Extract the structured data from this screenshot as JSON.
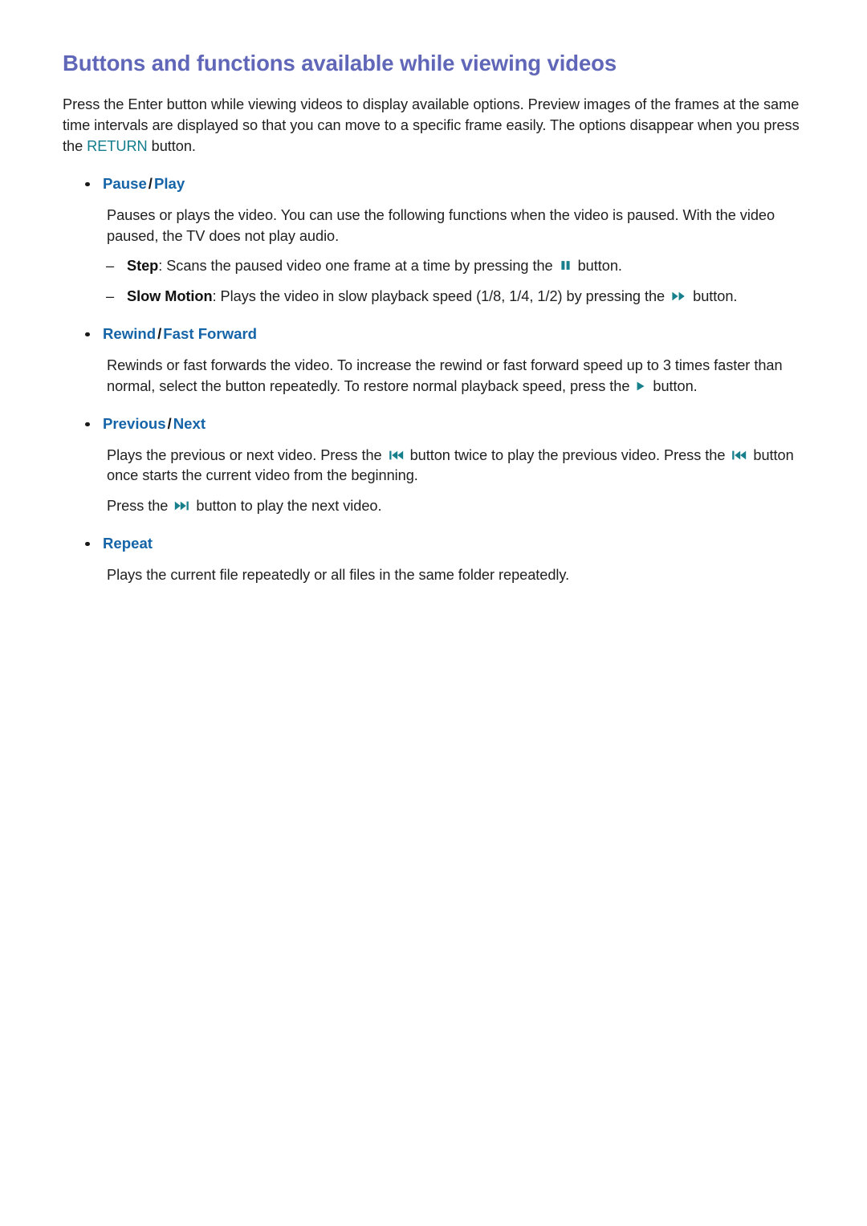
{
  "document": {
    "title": "Buttons and functions available while viewing videos",
    "intro_part1": "Press the Enter button while viewing videos to display available options. Preview images of the frames at the same time intervals are displayed so that you can move to a specific frame easily. The options disappear when you press the ",
    "intro_keyword": "RETURN",
    "intro_part2": " button."
  },
  "sections": [
    {
      "heading_first": "Pause",
      "heading_sep": "/",
      "heading_second": "Play",
      "paragraph": "Pauses or plays the video. You can use the following functions when the video is paused. With the video paused, the TV does not play audio.",
      "sub_items": [
        {
          "marker": "–",
          "label": "Step",
          "text_before": ": Scans the paused video one frame at a time by pressing the ",
          "icon": "pause-icon",
          "text_after": " button."
        },
        {
          "marker": "–",
          "label": "Slow Motion",
          "text_before": ": Plays the video in slow playback speed (1/8, 1/4, 1/2) by pressing the ",
          "icon": "fast-forward-icon",
          "text_after": " button."
        }
      ]
    },
    {
      "heading_first": "Rewind",
      "heading_sep": "/",
      "heading_second": "Fast Forward",
      "paragraph_before_icon": "Rewinds or fast forwards the video. To increase the rewind or fast forward speed up to 3 times faster than normal, select the button repeatedly. To restore normal playback speed, press the ",
      "icon": "play-icon",
      "paragraph_after_icon": " button."
    },
    {
      "heading_first": "Previous",
      "heading_sep": "/",
      "heading_second": "Next",
      "para1_a": "Plays the previous or next video. Press the ",
      "para1_icon1": "previous-icon",
      "para1_b": " button twice to play the previous video. Press the ",
      "para1_icon2": "previous-icon",
      "para1_c": " button once starts the current video from the beginning.",
      "para2_a": "Press the ",
      "para2_icon": "next-icon",
      "para2_b": " button to play the next video."
    },
    {
      "heading_first": "Repeat",
      "heading_sep": "",
      "heading_second": "",
      "paragraph": "Plays the current file repeatedly or all files in the same folder repeatedly."
    }
  ],
  "colors": {
    "title": "#6167b8",
    "heading": "#1564a8",
    "keyword_teal": "#127d8c",
    "icon_teal": "#18808c",
    "body_text": "#1f1f1f",
    "background": "#ffffff"
  }
}
